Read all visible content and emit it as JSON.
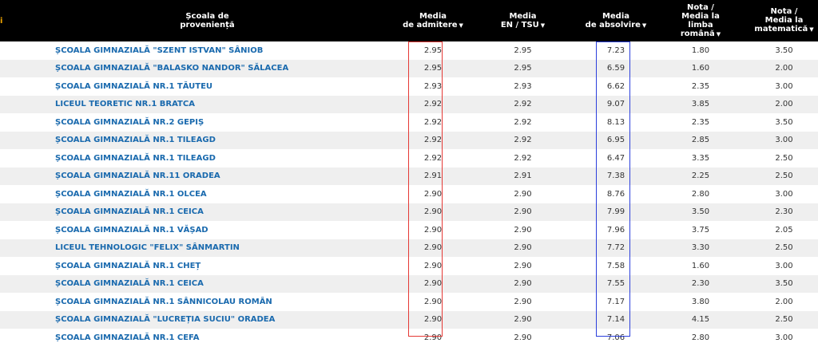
{
  "header": {
    "edge_mark": "i",
    "school_l1": "Școala de",
    "school_l2": "proveniență",
    "admission_l1": "Media",
    "admission_l2": "de admitere",
    "en_l1": "Media",
    "en_l2": "EN / TSU",
    "grad_l1": "Media",
    "grad_l2": "de absolvire",
    "ro_l1": "Nota /",
    "ro_l2": "Media la",
    "ro_l3": "limba",
    "ro_l4": "română",
    "mat_l1": "Nota /",
    "mat_l2": "Media la",
    "mat_l3": "matematică",
    "sort_arrow": "▼"
  },
  "rows": [
    {
      "school": "ȘCOALA GIMNAZIALĂ \"SZENT ISTVAN\" SÂNIOB",
      "admission": "2.95",
      "en": "2.95",
      "grad": "7.23",
      "ro": "1.80",
      "mat": "3.50"
    },
    {
      "school": "ȘCOALA GIMNAZIALĂ \"BALASKO NANDOR\" SĂLACEA",
      "admission": "2.95",
      "en": "2.95",
      "grad": "6.59",
      "ro": "1.60",
      "mat": "2.00"
    },
    {
      "school": "ȘCOALA GIMNAZIALĂ NR.1 TĂUTEU",
      "admission": "2.93",
      "en": "2.93",
      "grad": "6.62",
      "ro": "2.35",
      "mat": "3.00"
    },
    {
      "school": "LICEUL TEORETIC NR.1 BRATCA",
      "admission": "2.92",
      "en": "2.92",
      "grad": "9.07",
      "ro": "3.85",
      "mat": "2.00"
    },
    {
      "school": "ȘCOALA GIMNAZIALĂ NR.2 GEPIȘ",
      "admission": "2.92",
      "en": "2.92",
      "grad": "8.13",
      "ro": "2.35",
      "mat": "3.50"
    },
    {
      "school": "ȘCOALA GIMNAZIALĂ NR.1 TILEAGD",
      "admission": "2.92",
      "en": "2.92",
      "grad": "6.95",
      "ro": "2.85",
      "mat": "3.00"
    },
    {
      "school": "ȘCOALA GIMNAZIALĂ NR.1 TILEAGD",
      "admission": "2.92",
      "en": "2.92",
      "grad": "6.47",
      "ro": "3.35",
      "mat": "2.50"
    },
    {
      "school": "ȘCOALA GIMNAZIALĂ NR.11 ORADEA",
      "admission": "2.91",
      "en": "2.91",
      "grad": "7.38",
      "ro": "2.25",
      "mat": "2.50"
    },
    {
      "school": "ȘCOALA GIMNAZIALĂ NR.1 OLCEA",
      "admission": "2.90",
      "en": "2.90",
      "grad": "8.76",
      "ro": "2.80",
      "mat": "3.00"
    },
    {
      "school": "ȘCOALA GIMNAZIALĂ NR.1 CEICA",
      "admission": "2.90",
      "en": "2.90",
      "grad": "7.99",
      "ro": "3.50",
      "mat": "2.30"
    },
    {
      "school": "ȘCOALA GIMNAZIALĂ NR.1 VĂȘAD",
      "admission": "2.90",
      "en": "2.90",
      "grad": "7.96",
      "ro": "3.75",
      "mat": "2.05"
    },
    {
      "school": "LICEUL TEHNOLOGIC \"FELIX\" SÂNMARTIN",
      "admission": "2.90",
      "en": "2.90",
      "grad": "7.72",
      "ro": "3.30",
      "mat": "2.50"
    },
    {
      "school": "ȘCOALA GIMNAZIALĂ NR.1 CHEȚ",
      "admission": "2.90",
      "en": "2.90",
      "grad": "7.58",
      "ro": "1.60",
      "mat": "3.00"
    },
    {
      "school": "ȘCOALA GIMNAZIALĂ NR.1 CEICA",
      "admission": "2.90",
      "en": "2.90",
      "grad": "7.55",
      "ro": "2.30",
      "mat": "3.50"
    },
    {
      "school": "ȘCOALA GIMNAZIALĂ NR.1 SÂNNICOLAU ROMÂN",
      "admission": "2.90",
      "en": "2.90",
      "grad": "7.17",
      "ro": "3.80",
      "mat": "2.00"
    },
    {
      "school": "ȘCOALA GIMNAZIALĂ \"LUCREȚIA SUCIU\" ORADEA",
      "admission": "2.90",
      "en": "2.90",
      "grad": "7.14",
      "ro": "4.15",
      "mat": "2.50"
    },
    {
      "school": "ȘCOALA GIMNAZIALĂ NR.1 CEFA",
      "admission": "2.90",
      "en": "2.90",
      "grad": "7.06",
      "ro": "2.80",
      "mat": "3.00"
    }
  ]
}
